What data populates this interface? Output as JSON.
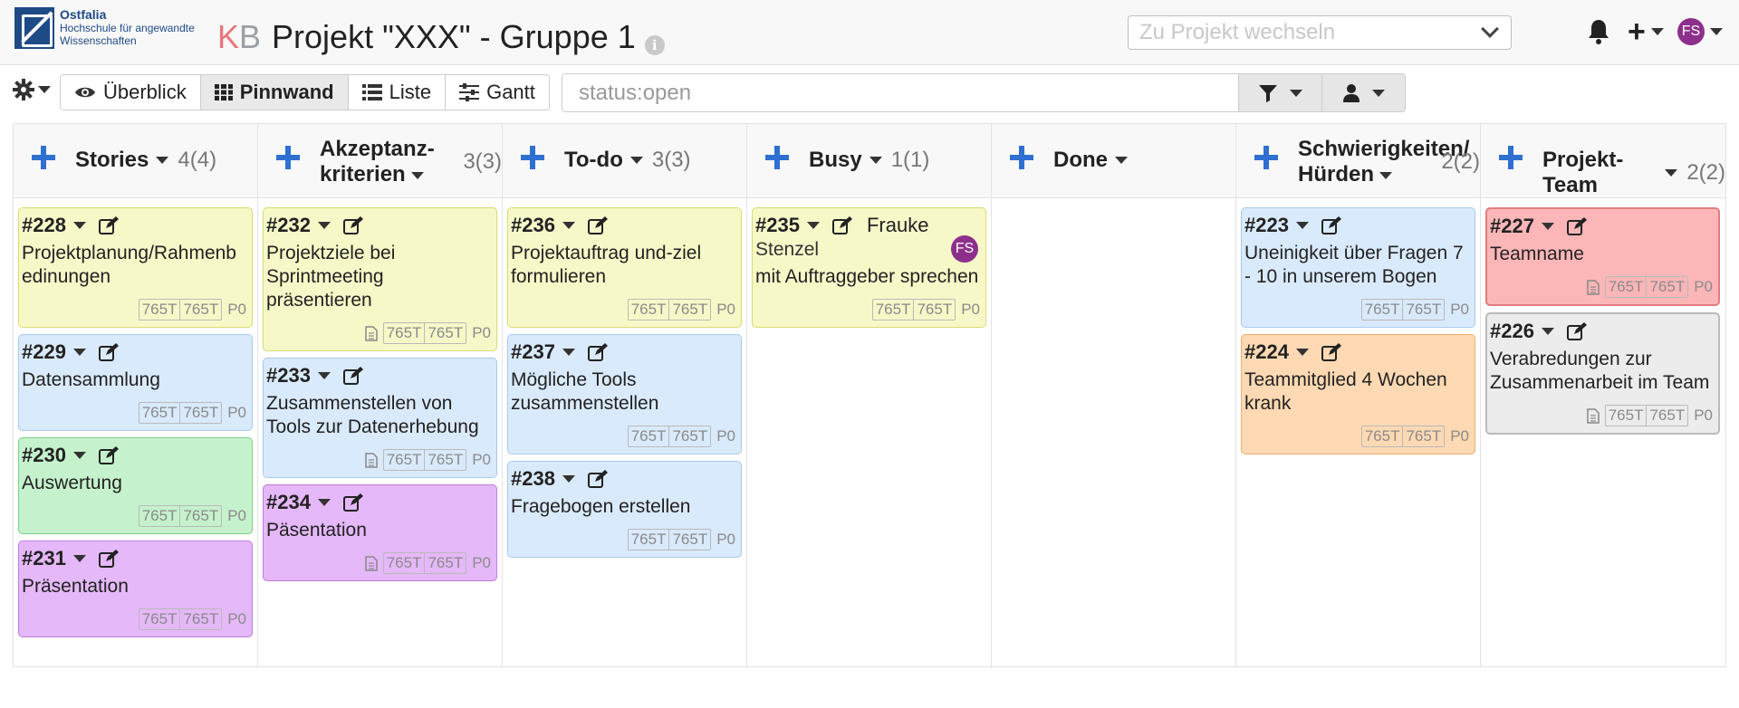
{
  "header": {
    "logo": {
      "name": "Ostfalia",
      "line1": "Hochschule für angewandte",
      "line2": "Wissenschaften"
    },
    "title_prefix_k": "K",
    "title_prefix_b": "B",
    "title": "Projekt \"XXX\" - Gruppe 1",
    "project_switch_placeholder": "Zu Projekt wechseln",
    "user_initials": "FS"
  },
  "toolbar": {
    "tabs": [
      {
        "label": "Überblick",
        "icon": "eye-icon"
      },
      {
        "label": "Pinnwand",
        "icon": "grid-icon",
        "active": true
      },
      {
        "label": "Liste",
        "icon": "list-icon"
      },
      {
        "label": "Gantt",
        "icon": "sliders-icon"
      }
    ],
    "search_placeholder": "status:open"
  },
  "colors": {
    "yellow": "#f7f8c8",
    "blue": "#d9eafc",
    "green": "#c5f2cc",
    "purple": "#e5b8f9",
    "orange": "#ffd9b3",
    "red": "#fdb6b8",
    "gray": "#ececec",
    "accent_plus": "#2f6fd1",
    "avatar": "#8e2f8c"
  },
  "columns": [
    {
      "title": "Stories",
      "count": "4(4)",
      "cards": [
        {
          "id": "#228",
          "title": "Projektplanung/Rahmenb edinungen",
          "color": "yellow",
          "tag1": "765T",
          "tag2": "765T",
          "prio": "P0"
        },
        {
          "id": "#229",
          "title": "Datensammlung",
          "color": "blue",
          "tag1": "765T",
          "tag2": "765T",
          "prio": "P0"
        },
        {
          "id": "#230",
          "title": "Auswertung",
          "color": "green",
          "tag1": "765T",
          "tag2": "765T",
          "prio": "P0"
        },
        {
          "id": "#231",
          "title": "Präsentation",
          "color": "purple",
          "tag1": "765T",
          "tag2": "765T",
          "prio": "P0"
        }
      ]
    },
    {
      "title": "Akzeptanz-kriterien",
      "count": "3(3)",
      "cards": [
        {
          "id": "#232",
          "title": "Projektziele bei Sprintmeeting präsentieren",
          "color": "yellow",
          "tag1": "765T",
          "tag2": "765T",
          "prio": "P0",
          "doc": true
        },
        {
          "id": "#233",
          "title": "Zusammenstellen von Tools zur Datenerhebung",
          "color": "blue",
          "tag1": "765T",
          "tag2": "765T",
          "prio": "P0",
          "doc": true
        },
        {
          "id": "#234",
          "title": "Päsentation",
          "color": "purple",
          "tag1": "765T",
          "tag2": "765T",
          "prio": "P0",
          "doc": true
        }
      ]
    },
    {
      "title": "To-do",
      "count": "3(3)",
      "cards": [
        {
          "id": "#236",
          "title": "Projektauftrag und-ziel formulieren",
          "color": "yellow",
          "tag1": "765T",
          "tag2": "765T",
          "prio": "P0"
        },
        {
          "id": "#237",
          "title": "Mögliche Tools zusammenstellen",
          "color": "blue",
          "tag1": "765T",
          "tag2": "765T",
          "prio": "P0"
        },
        {
          "id": "#238",
          "title": "Fragebogen erstellen",
          "color": "blue",
          "tag1": "765T",
          "tag2": "765T",
          "prio": "P0"
        }
      ]
    },
    {
      "title": "Busy",
      "count": "1(1)",
      "cards": [
        {
          "id": "#235",
          "assignee": "Frauke Stenzel",
          "assignee_initials": "FS",
          "title": "mit Auftraggeber sprechen",
          "color": "yellow",
          "tag1": "765T",
          "tag2": "765T",
          "prio": "P0"
        }
      ]
    },
    {
      "title": "Done",
      "count": "",
      "cards": []
    },
    {
      "title": "Schwierigkeiten/ Hürden",
      "count": "2(2)",
      "cards": [
        {
          "id": "#223",
          "title": "Uneinigkeit über Fragen 7 - 10 in unserem Bogen",
          "color": "blue",
          "tag1": "765T",
          "tag2": "765T",
          "prio": "P0"
        },
        {
          "id": "#224",
          "title": "Teammitglied 4 Wochen krank",
          "color": "orange",
          "tag1": "765T",
          "tag2": "765T",
          "prio": "P0"
        }
      ]
    },
    {
      "title": "Projekt-Team",
      "count": "2(2)",
      "cards": [
        {
          "id": "#227",
          "title": "Teamname",
          "color": "red",
          "tag1": "765T",
          "tag2": "765T",
          "prio": "P0",
          "doc": true
        },
        {
          "id": "#226",
          "title": "Verabredungen zur Zusammenarbeit im Team",
          "color": "gray",
          "tag1": "765T",
          "tag2": "765T",
          "prio": "P0",
          "doc": true
        }
      ]
    }
  ]
}
